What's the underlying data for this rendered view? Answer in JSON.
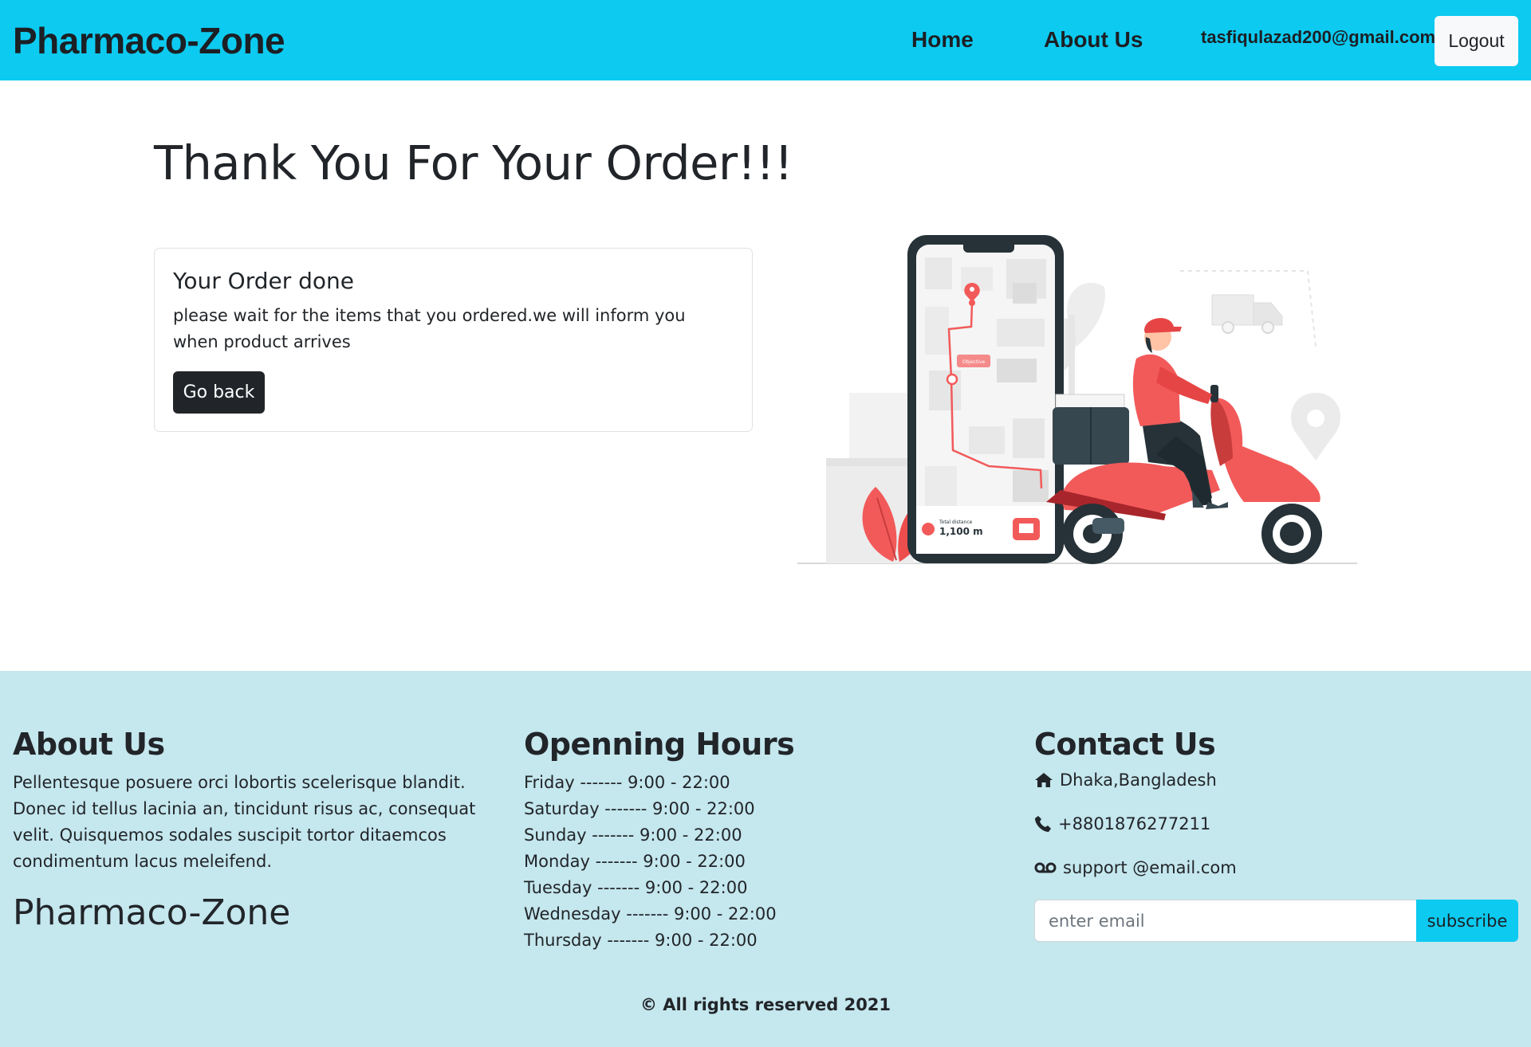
{
  "navbar": {
    "brand": "Pharmaco-Zone",
    "links": [
      {
        "label": "Home"
      },
      {
        "label": "About Us"
      }
    ],
    "user_email": "tasfiqulazad200@gmail.com",
    "logout_label": "Logout",
    "background_color": "#0dcaf0"
  },
  "main": {
    "title": "Thank You For Your Order!!!",
    "card": {
      "title": "Your Order done",
      "text": "please wait for the items that you ordered.we will inform you when product arrives",
      "button_label": "Go back"
    },
    "illustration": {
      "icon": "delivery-scooter-illustration",
      "objective_label": "Objective",
      "distance_label": "Total distance",
      "distance_value": "1,100 m"
    }
  },
  "footer": {
    "background_color": "#c5e7ee",
    "about": {
      "heading": "About Us",
      "text": "Pellentesque posuere orci lobortis scelerisque blandit. Donec id tellus lacinia an, tincidunt risus ac, consequat velit. Quisquemos sodales suscipit tortor ditaemcos condimentum lacus meleifend.",
      "brand": "Pharmaco-Zone"
    },
    "hours": {
      "heading": "Openning Hours",
      "items": [
        "Friday ------- 9:00 - 22:00",
        "Saturday ------- 9:00 - 22:00",
        "Sunday ------- 9:00 - 22:00",
        "Monday ------- 9:00 - 22:00",
        "Tuesday ------- 9:00 - 22:00",
        "Wednesday ------- 9:00 - 22:00",
        "Thursday ------- 9:00 - 22:00"
      ]
    },
    "contact": {
      "heading": "Contact Us",
      "address": "Dhaka,Bangladesh",
      "phone": "+8801876277211",
      "email": "support @email.com",
      "icons": [
        "home-icon",
        "phone-icon",
        "voicemail-icon"
      ],
      "input_placeholder": "enter email",
      "subscribe_label": "subscribe"
    },
    "copyright": "© All rights reserved 2021"
  }
}
